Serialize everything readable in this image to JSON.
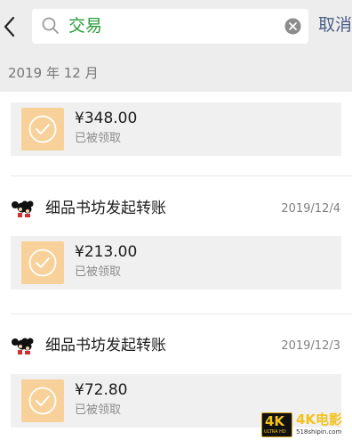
{
  "search": {
    "query": "交易",
    "cancel_label": "取消"
  },
  "month_label": "2019 年 12 月",
  "entries": [
    {
      "amount": "¥348.00",
      "status": "已被领取"
    },
    {
      "sender": "细品书坊发起转账",
      "date": "2019/12/4",
      "amount": "¥213.00",
      "status": "已被领取"
    },
    {
      "sender": "细品书坊发起转账",
      "date": "2019/12/3",
      "amount": "¥72.80",
      "status": "已被领取"
    }
  ],
  "watermark": {
    "badge": "4K",
    "badge_sub": "ULTRA HD",
    "text": "4K电影",
    "site": "518shipin.com"
  },
  "colors": {
    "accent_green": "#2a9d3a",
    "link_blue": "#4a5f87",
    "transfer_icon_bg": "#f7d199"
  }
}
